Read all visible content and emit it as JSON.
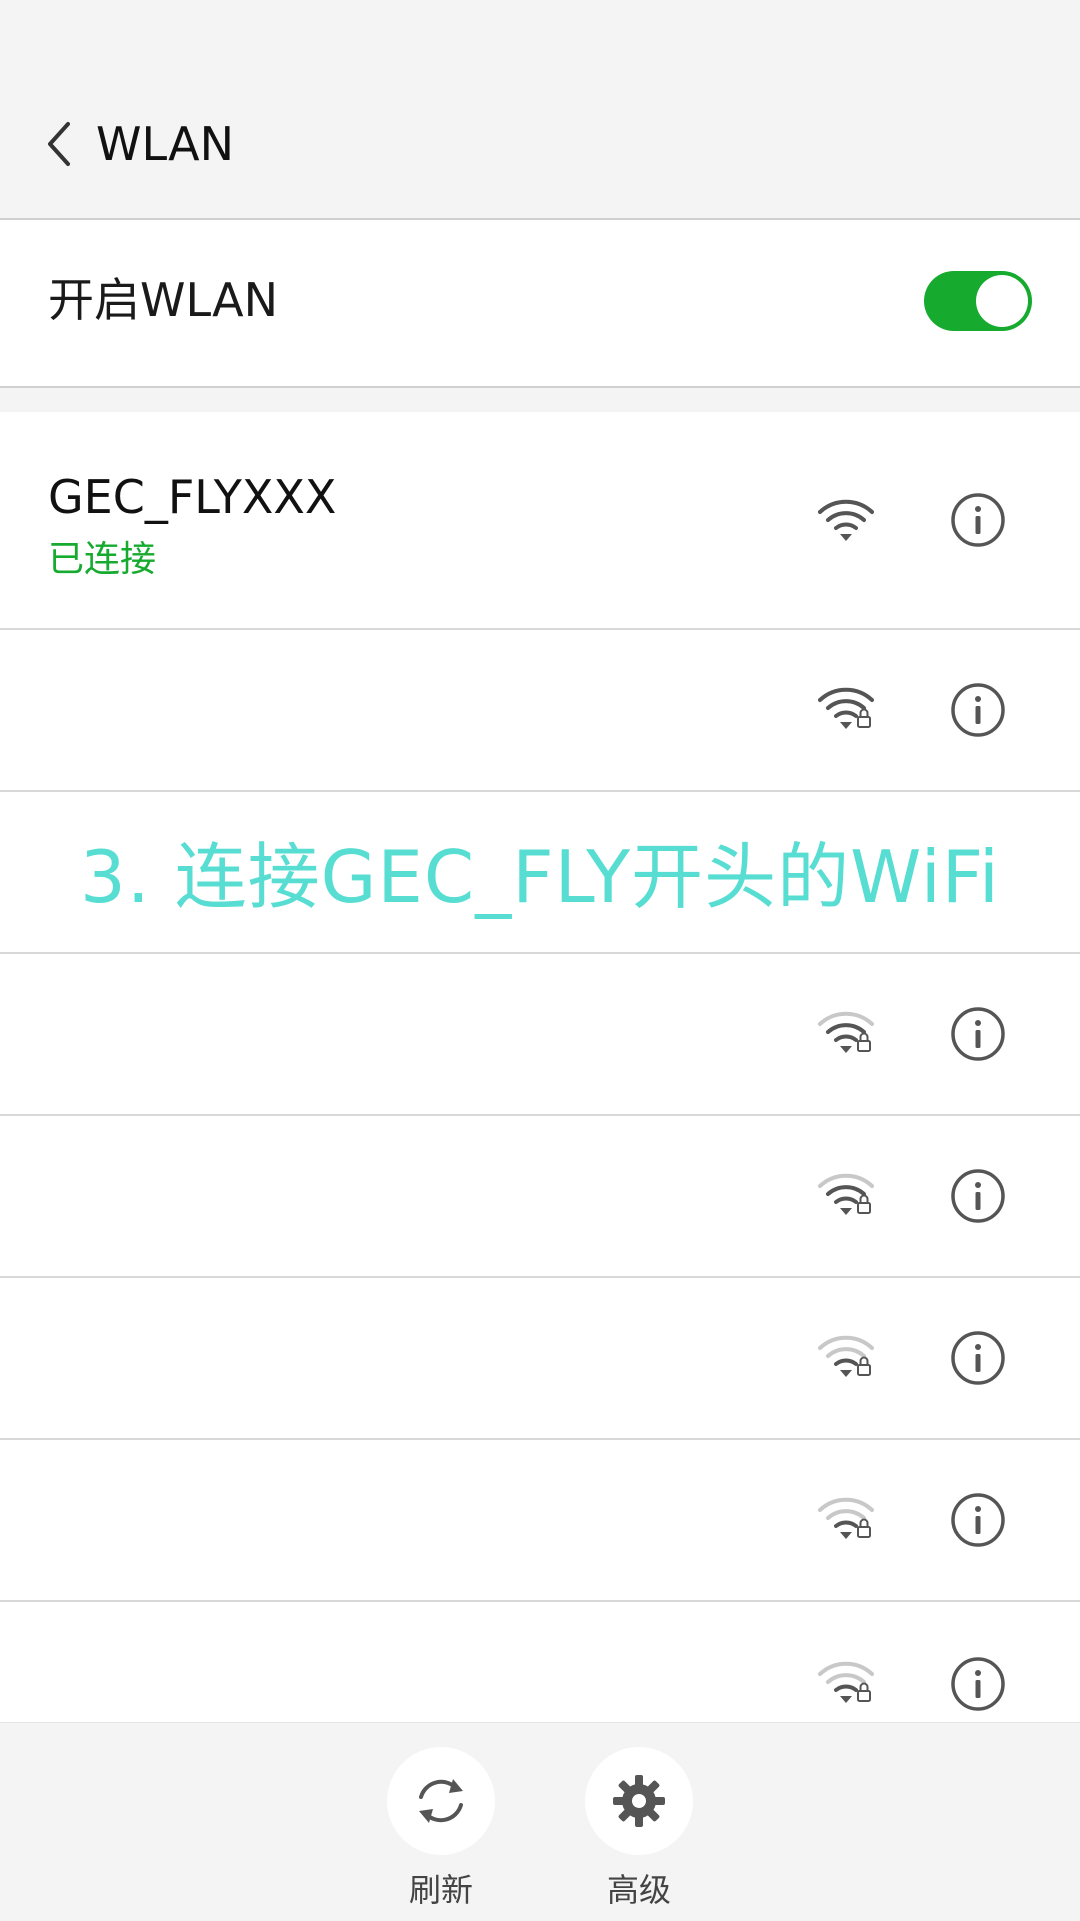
{
  "header": {
    "title": "WLAN"
  },
  "wlan_toggle": {
    "label": "开启WLAN",
    "enabled": true
  },
  "networks": [
    {
      "name": "GEC_FLYXXX",
      "status": "已连接",
      "secured": false,
      "signal": 4
    },
    {
      "name": "",
      "secured": true,
      "signal": 4
    },
    {
      "name": "",
      "secured": true,
      "signal": 3
    },
    {
      "name": "",
      "secured": true,
      "signal": 3
    },
    {
      "name": "",
      "secured": true,
      "signal": 2
    },
    {
      "name": "",
      "secured": true,
      "signal": 2
    },
    {
      "name": "",
      "secured": true,
      "signal": 2
    }
  ],
  "overlay_caption": "3. 连接GEC_FLY开头的WiFi",
  "bottom_actions": {
    "refresh": "刷新",
    "advanced": "高级"
  },
  "colors": {
    "accent": "#16aa2f",
    "caption": "#58ddd2",
    "icon": "#555555"
  }
}
